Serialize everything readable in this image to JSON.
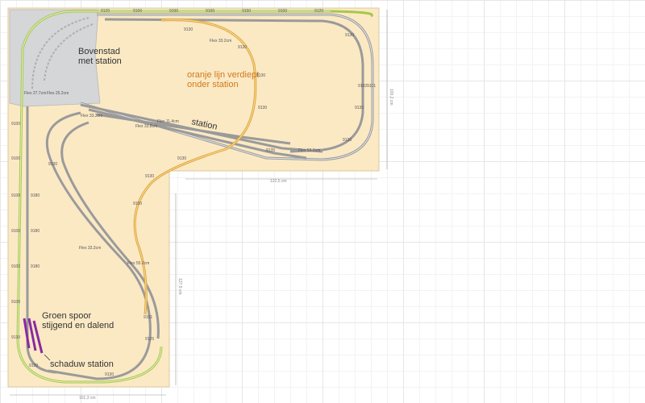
{
  "labels": {
    "bovenstad_1": "Bovenstad",
    "bovenstad_2": "met station",
    "oranje_1": "oranje lijn verdiept",
    "oranje_2": "onder station",
    "station": "station",
    "groen_1": "Groen spoor",
    "groen_2": "stijgend en dalend",
    "schaduw": "schaduw station"
  },
  "track_labels": {
    "flex_a": "Flex 33.2cm",
    "flex_b": "Flex 55.2cm",
    "flex_c": "Flex 33.3cm",
    "flex_d": "Flex 11.4cm",
    "flex_e": "Flex 33.8cm",
    "flex_f": "Flex 27.7cm",
    "flex_g": "Flex 25.2cm",
    "flex_h": "Flex 33.3cm",
    "flex_i": "Flex 53.2cm",
    "piece_9130": "9130",
    "piece_9100": "9100",
    "piece_9150": "9150",
    "piece_9120": "9120",
    "piece_9101": "9101",
    "piece_9102": "9102",
    "piece_9151": "9151",
    "piece_9125": "9125",
    "piece_9135": "9135",
    "piece_9180": "9180"
  },
  "dimensions": {
    "top_right": "100,2 cm",
    "middle_bottom": "122,5 cm",
    "lower_vertical": "127,5 cm",
    "bottom": "101,3 cm"
  },
  "colors": {
    "baseboard": "#fbe9c4",
    "upper_level": "#d4d6d8",
    "green_track": "#a6c84a",
    "orange_track": "#e0a63a",
    "grey_track": "#9a9a9a",
    "purple_track": "#8a2aa0",
    "dimension_line": "#9a9a9a"
  }
}
